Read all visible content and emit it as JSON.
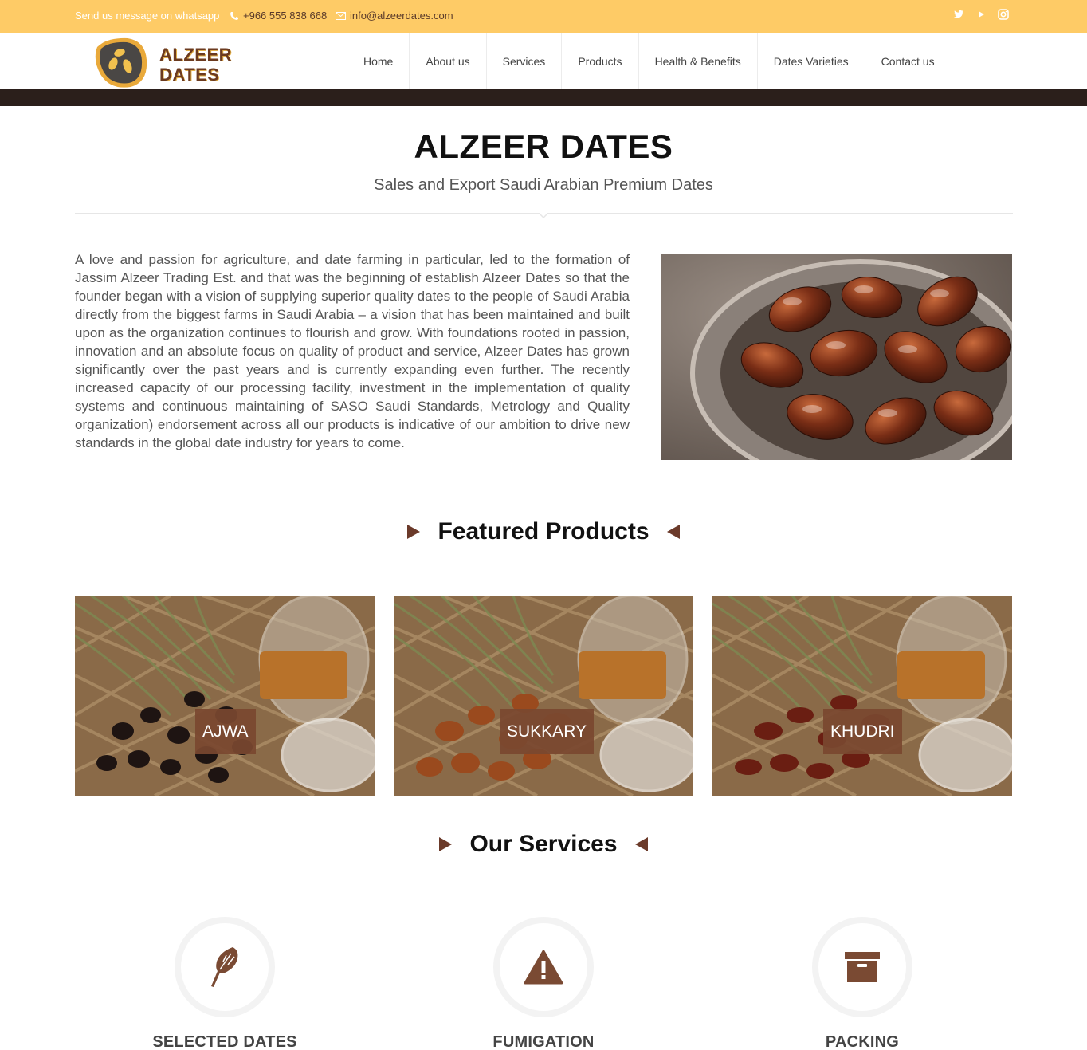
{
  "topbar": {
    "whatsapp": "Send us message on whatsapp",
    "phone": "+966 555 838 668",
    "email": "info@alzeerdates.com",
    "social_icons": [
      "twitter-icon",
      "youtube-icon",
      "instagram-icon"
    ]
  },
  "logo": {
    "line1": "ALZEER",
    "line2": "DATES"
  },
  "nav": {
    "items": [
      {
        "label": "Home",
        "active": true
      },
      {
        "label": "About us"
      },
      {
        "label": "Services"
      },
      {
        "label": "Products"
      },
      {
        "label": "Health & Benefits"
      },
      {
        "label": "Dates Varieties"
      },
      {
        "label": "Contact us"
      }
    ]
  },
  "hero": {
    "title": "ALZEER DATES",
    "subtitle": "Sales and Export Saudi Arabian Premium Dates"
  },
  "intro": {
    "text": "A love and passion for agriculture, and date farming in particular, led to the formation of Jassim Alzeer Trading Est. and that was the beginning of establish Alzeer Dates so that the founder began with a vision of supplying superior quality dates to the people of Saudi Arabia directly from the biggest farms in Saudi Arabia – a vision that has been maintained and built upon as the organization continues to flourish and grow. With foundations rooted in passion, innovation and an absolute focus on quality of product and service, Alzeer Dates has grown significantly over the past years and is currently expanding even further. The recently increased capacity of our processing facility, investment in the implementation of quality systems and continuous maintaining of SASO Saudi Standards, Metrology and Quality organization) endorsement across all our products is indicative of our ambition to drive new standards in the global date industry for years to come."
  },
  "featured": {
    "heading": "Featured Products",
    "products": [
      {
        "label": "AJWA"
      },
      {
        "label": "SUKKARY"
      },
      {
        "label": "KHUDRI"
      }
    ]
  },
  "services": {
    "heading": "Our Services",
    "items": [
      {
        "label": "SELECTED DATES",
        "icon": "feather-icon"
      },
      {
        "label": "FUMIGATION",
        "icon": "warning-icon"
      },
      {
        "label": "PACKING",
        "icon": "archive-box-icon"
      }
    ]
  },
  "colors": {
    "topbar": "#fecb66",
    "accent_brown": "#7a4a33",
    "dark_strip": "#2b1f1b"
  }
}
